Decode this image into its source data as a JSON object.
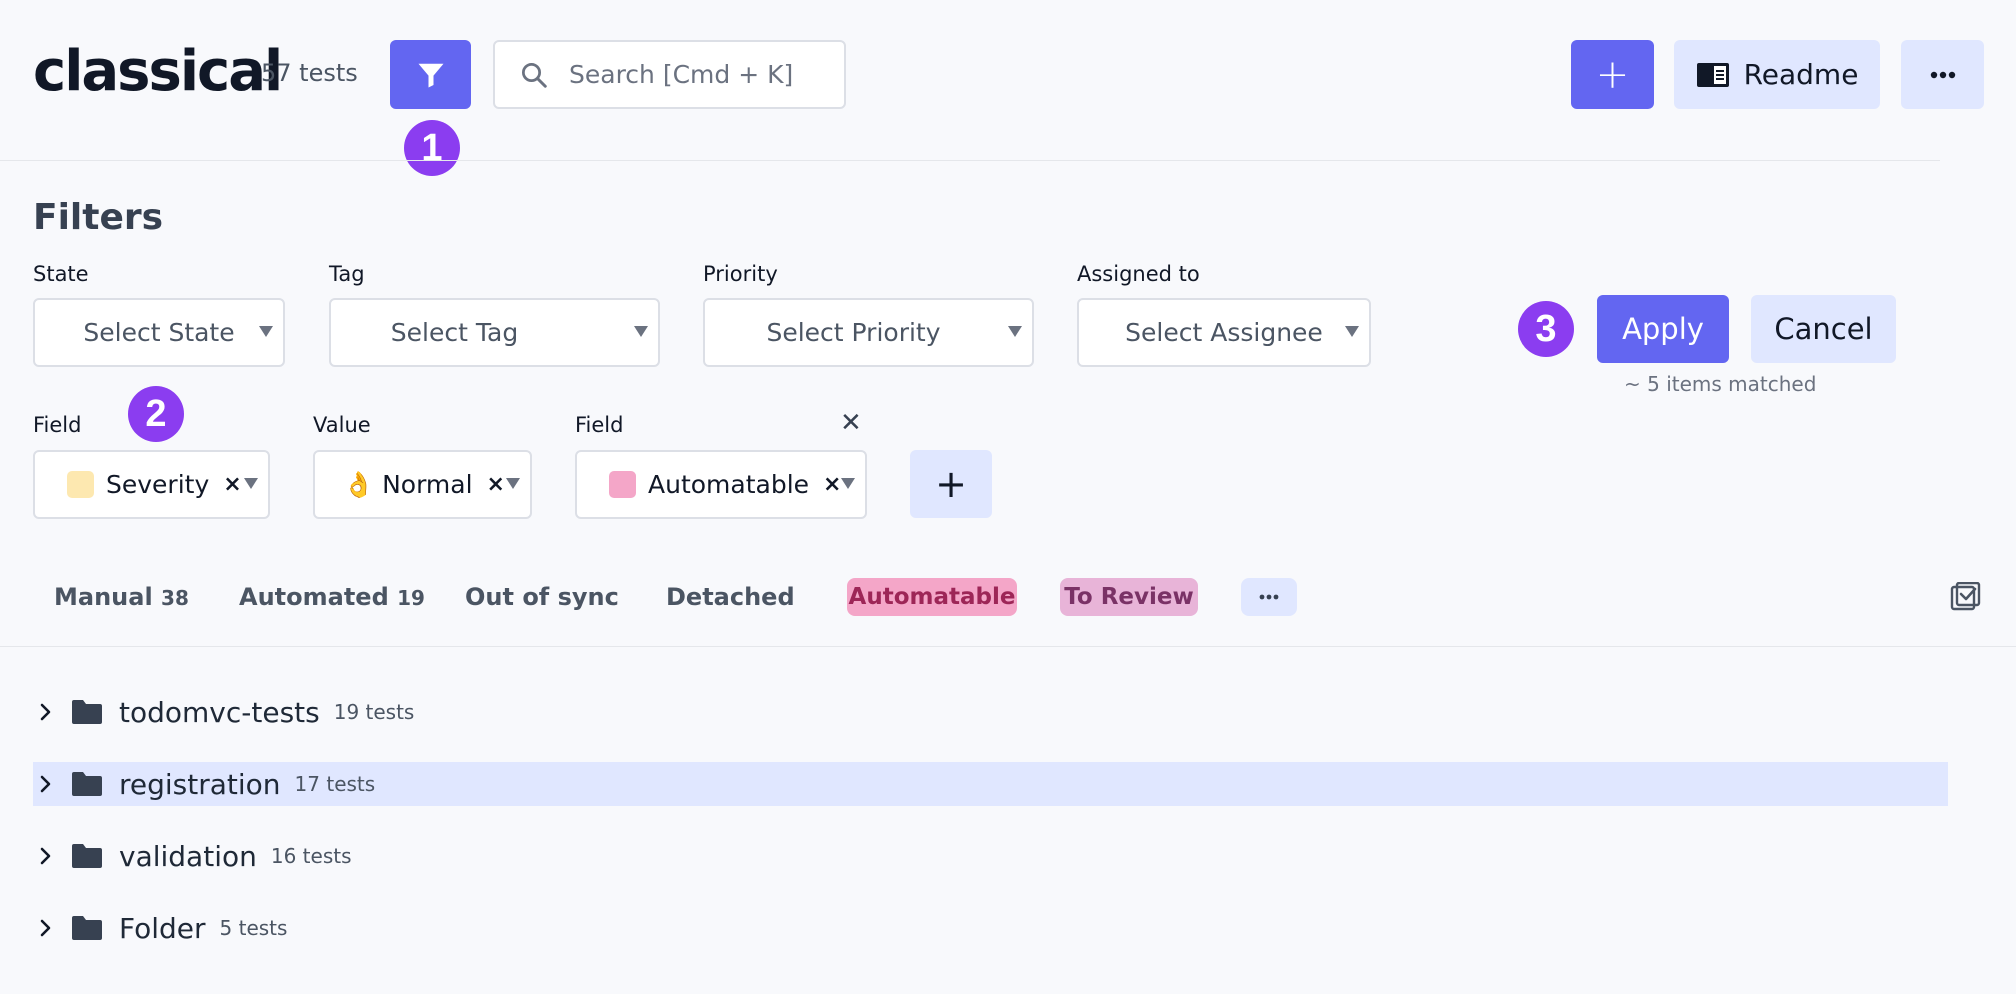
{
  "header": {
    "project_title": "classical",
    "test_count": "57 tests",
    "search_placeholder": "Search [Cmd + K]",
    "add_label": "+",
    "readme_label": "Readme"
  },
  "badges": {
    "one": "1",
    "two": "2",
    "three": "3"
  },
  "filters": {
    "title": "Filters",
    "state": {
      "label": "State",
      "placeholder": "Select State"
    },
    "tag": {
      "label": "Tag",
      "placeholder": "Select Tag"
    },
    "priority": {
      "label": "Priority",
      "placeholder": "Select Priority"
    },
    "assigned": {
      "label": "Assigned to",
      "placeholder": "Select Assignee"
    },
    "field1": {
      "label": "Field",
      "value": "Severity",
      "color": "#fde8b0"
    },
    "value1": {
      "label": "Value",
      "value": "👌 Normal"
    },
    "field2": {
      "label": "Field",
      "value": "Automatable",
      "color": "#f4a6c8"
    },
    "remove_mark": "×",
    "close_mark": "✕",
    "add_field": "+",
    "apply_label": "Apply",
    "cancel_label": "Cancel",
    "matched_text": "~ 5 items matched"
  },
  "tabs": [
    {
      "label": "Manual",
      "count": "38"
    },
    {
      "label": "Automated",
      "count": "19"
    },
    {
      "label": "Out of sync",
      "count": ""
    },
    {
      "label": "Detached",
      "count": ""
    }
  ],
  "chips": [
    {
      "label": "Automatable",
      "bg": "#f4a6c8",
      "fg": "#9d2657"
    },
    {
      "label": "To Review",
      "bg": "#e8b4d8",
      "fg": "#7a3266"
    }
  ],
  "tree": [
    {
      "name": "todomvc-tests",
      "count": "19 tests"
    },
    {
      "name": "registration",
      "count": "17 tests"
    },
    {
      "name": "validation",
      "count": "16 tests"
    },
    {
      "name": "Folder",
      "count": "5 tests"
    }
  ],
  "colors": {
    "accent": "#6366f1",
    "badge": "#8b3df0",
    "highlight": "#e0e7ff"
  }
}
